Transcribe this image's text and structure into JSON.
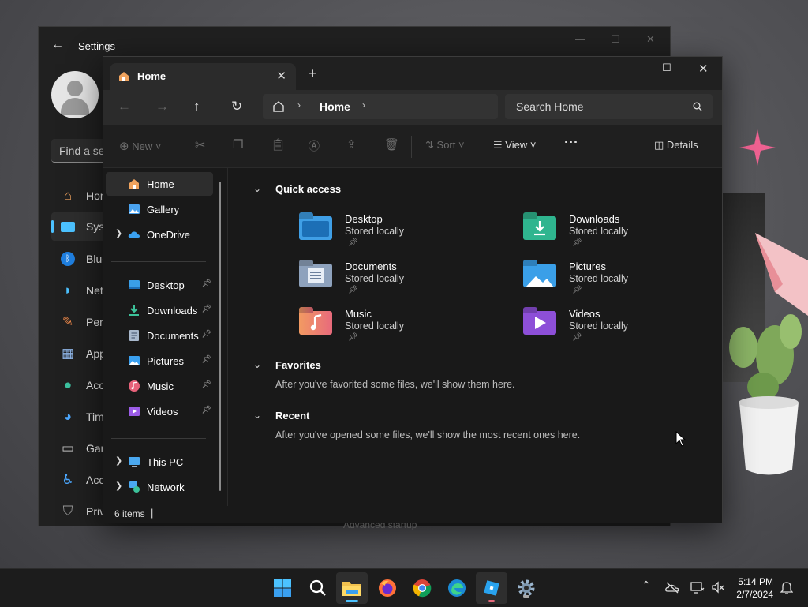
{
  "settings": {
    "title": "Settings",
    "search_placeholder": "Find a se",
    "nav": [
      "Hom",
      "Syst",
      "Blue",
      "Net",
      "Pers",
      "App",
      "Acco",
      "Tim",
      "Gam",
      "Acce",
      "Priv"
    ],
    "bottom_text": "Advanced startup"
  },
  "explorer": {
    "tab_title": "Home",
    "breadcrumb": "Home",
    "search_placeholder": "Search Home",
    "commands": {
      "new": "New",
      "sort": "Sort",
      "view": "View",
      "details": "Details"
    },
    "nav_pane": {
      "top": [
        "Home",
        "Gallery",
        "OneDrive"
      ],
      "pinned": [
        "Desktop",
        "Downloads",
        "Documents",
        "Pictures",
        "Music",
        "Videos"
      ],
      "bottom": [
        "This PC",
        "Network"
      ]
    },
    "quick_access": {
      "header": "Quick access",
      "items": [
        {
          "name": "Desktop",
          "status": "Stored locally"
        },
        {
          "name": "Downloads",
          "status": "Stored locally"
        },
        {
          "name": "Documents",
          "status": "Stored locally"
        },
        {
          "name": "Pictures",
          "status": "Stored locally"
        },
        {
          "name": "Music",
          "status": "Stored locally"
        },
        {
          "name": "Videos",
          "status": "Stored locally"
        }
      ]
    },
    "favorites": {
      "header": "Favorites",
      "message": "After you've favorited some files, we'll show them here."
    },
    "recent": {
      "header": "Recent",
      "message": "After you've opened some files, we'll show the most recent ones here."
    },
    "status_bar": "6 items"
  },
  "taskbar": {
    "time": "5:14 PM",
    "date": "2/7/2024"
  },
  "colors": {
    "accent": "#4cc2ff",
    "window_bg": "#191919",
    "taskbar_bg": "#1c1c1c"
  }
}
